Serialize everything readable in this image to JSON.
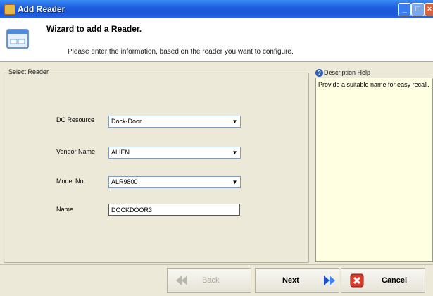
{
  "window": {
    "title": "Add Reader"
  },
  "header": {
    "title": "Wizard to add a Reader.",
    "subtitle": "Please enter the information, based on the reader you want to configure."
  },
  "select_reader": {
    "legend": "Select Reader",
    "fields": {
      "dc_resource": {
        "label": "DC Resource",
        "value": "Dock-Door"
      },
      "vendor_name": {
        "label": "Vendor Name",
        "value": "ALIEN"
      },
      "model_no": {
        "label": "Model No.",
        "value": "ALR9800"
      },
      "name": {
        "label": "Name",
        "value": "DOCKDOOR3"
      }
    }
  },
  "help": {
    "legend": "Description Help",
    "text": "Provide a suitable name for easy recall."
  },
  "footer": {
    "back_label": "Back",
    "next_label": "Next",
    "cancel_label": "Cancel"
  },
  "colors": {
    "titlebar": "#1e5fe0",
    "panel": "#ece9d8",
    "help_bg": "#ffffe1"
  },
  "icons": [
    "wizard-window-icon",
    "back-arrows-icon",
    "next-arrows-icon",
    "cancel-x-icon",
    "help-icon"
  ]
}
